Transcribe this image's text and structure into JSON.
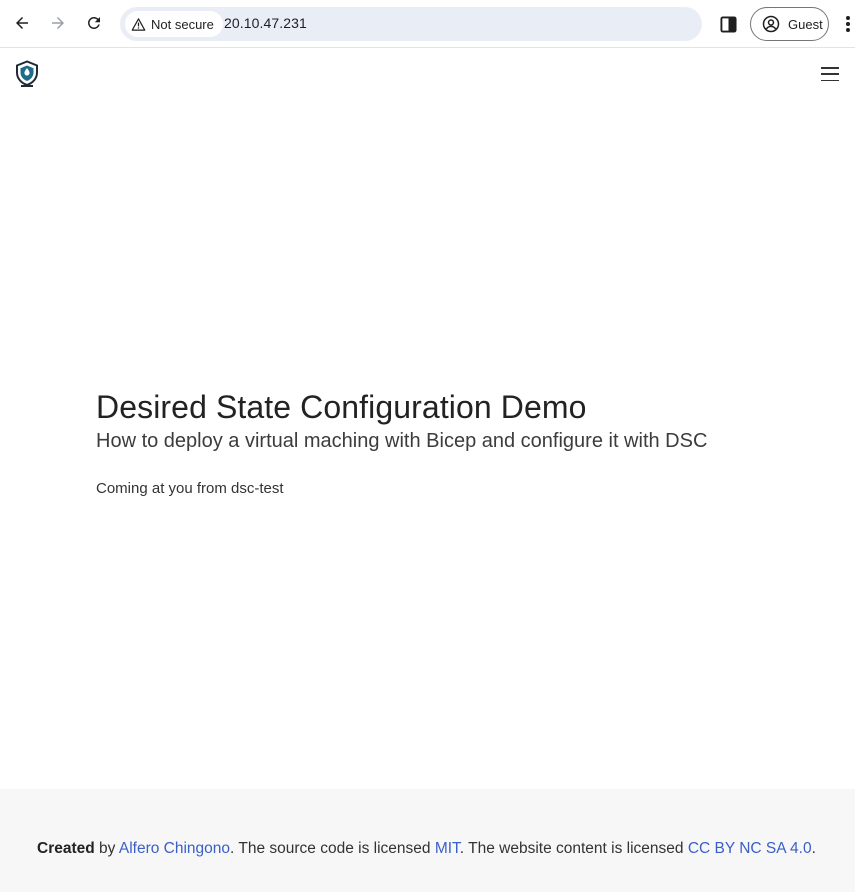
{
  "browser": {
    "security_label": "Not secure",
    "url": "20.10.47.231",
    "profile_label": "Guest"
  },
  "hero": {
    "title": "Desired State Configuration Demo",
    "subtitle": "How to deploy a virtual maching with Bicep and configure it with DSC",
    "host_line": "Coming at you from dsc-test"
  },
  "footer": {
    "created": "Created",
    "by": " by ",
    "author": "Alfero Chingono",
    "source_text": ". The source code is licensed ",
    "source_license": "MIT",
    "content_text": ". The website content is licensed ",
    "content_license": "CC BY NC SA 4.0",
    "end": "."
  },
  "colors": {
    "link": "#3a5fc8",
    "omnibox": "#e9edf6",
    "footer_bg": "#f7f7f7",
    "logo": "#1c6c8c"
  },
  "icons": [
    "back-arrow-icon",
    "forward-arrow-icon",
    "reload-icon",
    "warning-icon",
    "side-panel-icon",
    "account-circle-icon",
    "kebab-menu-icon",
    "site-logo-icon",
    "hamburger-menu-icon"
  ]
}
